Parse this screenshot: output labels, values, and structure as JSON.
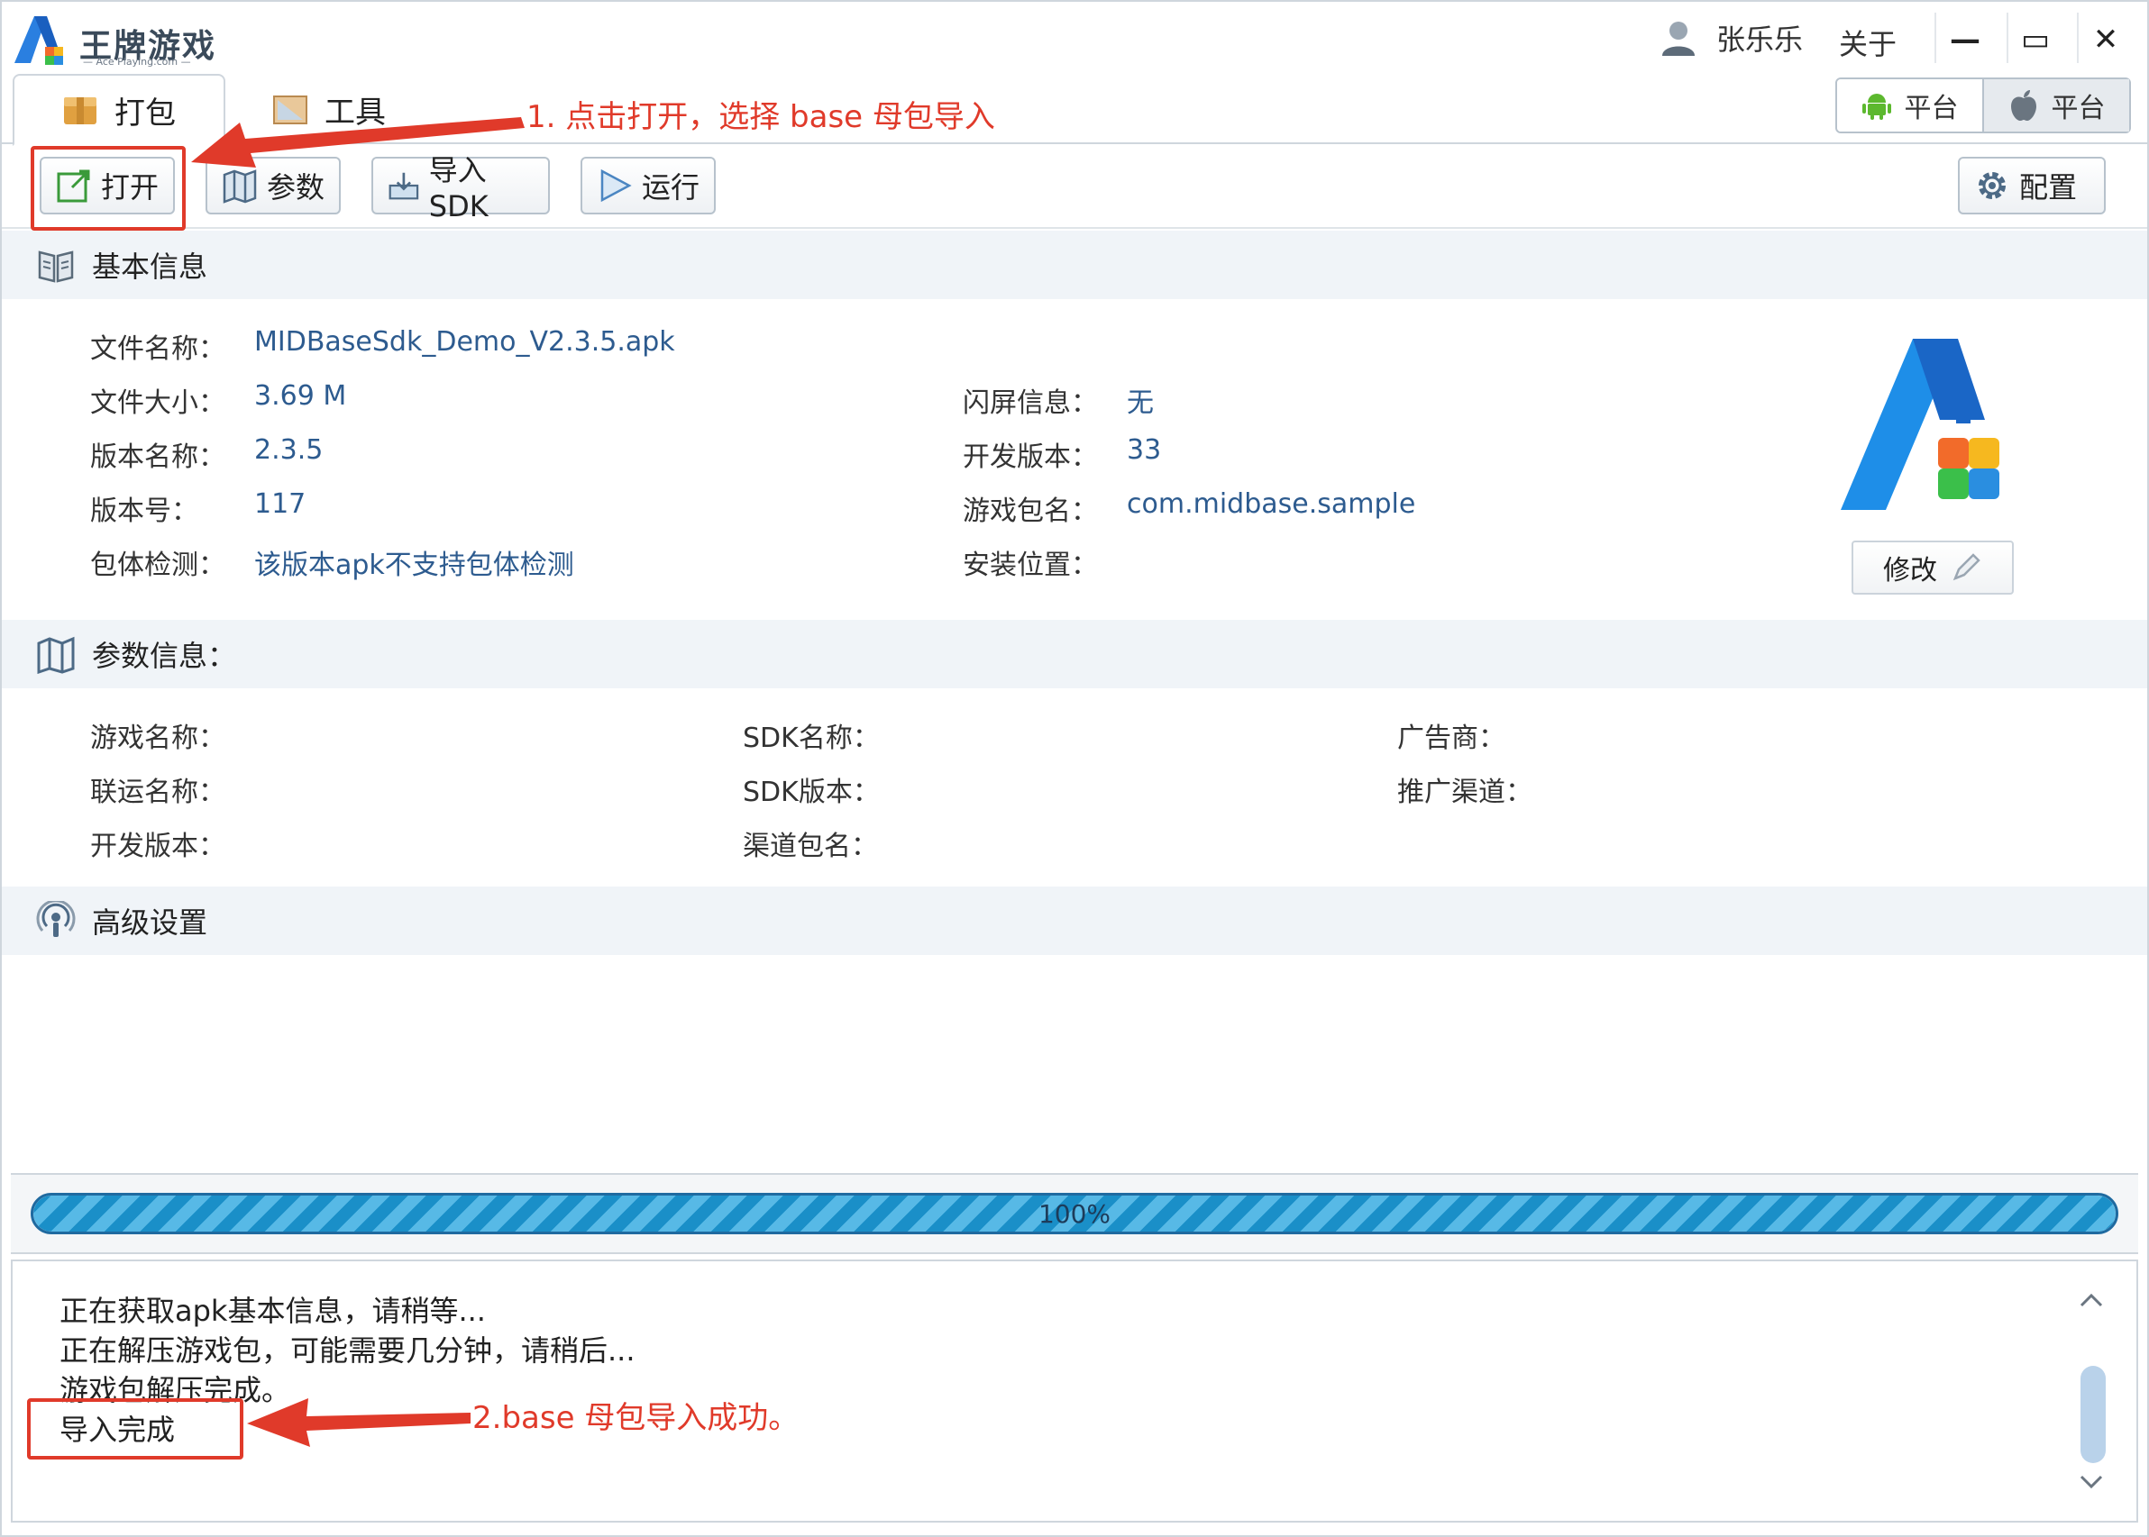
{
  "app": {
    "logo_name": "王牌游戏",
    "logo_sub": "— Ace Playing.com —",
    "user_name": "张乐乐",
    "about_label": "关于",
    "minimize": "—",
    "maximize": "▭",
    "close": "✕"
  },
  "tabs": [
    {
      "label": "打包",
      "active": true
    },
    {
      "label": "工具",
      "active": false
    }
  ],
  "platforms": [
    {
      "label": "平台",
      "os": "android"
    },
    {
      "label": "平台",
      "os": "ios"
    }
  ],
  "toolbar": {
    "open_label": "打开",
    "params_label": "参数",
    "import_sdk_label": "导入SDK",
    "run_label": "运行",
    "config_label": "配置"
  },
  "basic_info": {
    "title": "基本信息",
    "file_name_label": "文件名称：",
    "file_name": "MIDBaseSdk_Demo_V2.3.5.apk",
    "file_size_label": "文件大小：",
    "file_size": "3.69 M",
    "version_name_label": "版本名称：",
    "version_name": "2.3.5",
    "version_code_label": "版本号：",
    "version_code": "117",
    "package_check_label": "包体检测：",
    "package_check": "该版本apk不支持包体检测",
    "splash_label": "闪屏信息：",
    "splash": "无",
    "dev_version_label": "开发版本：",
    "dev_version": "33",
    "package_name_label": "游戏包名：",
    "package_name": "com.midbase.sample",
    "install_location_label": "安装位置：",
    "edit_label": "修改"
  },
  "params_info": {
    "title": "参数信息：",
    "game_name_label": "游戏名称：",
    "joint_name_label": "联运名称：",
    "dev_version_label": "开发版本：",
    "sdk_name_label": "SDK名称：",
    "sdk_version_label": "SDK版本：",
    "channel_package_label": "渠道包名：",
    "advertiser_label": "广告商：",
    "promo_channel_label": "推广渠道："
  },
  "advanced": {
    "title": "高级设置"
  },
  "progress": {
    "value": 100,
    "text": "100%"
  },
  "log": {
    "lines": [
      "正在获取apk基本信息，请稍等...",
      "正在解压游戏包，可能需要几分钟，请稍后...",
      "游戏包解压完成。",
      "导入完成"
    ]
  },
  "annotations": {
    "step1": "1. 点击打开，选择 base 母包导入",
    "step2": "2.base 母包导入成功。"
  },
  "colors": {
    "accent_blue": "#1a8fc8",
    "annotation_red": "#e03a2a",
    "value_blue": "#2d5b8f"
  }
}
